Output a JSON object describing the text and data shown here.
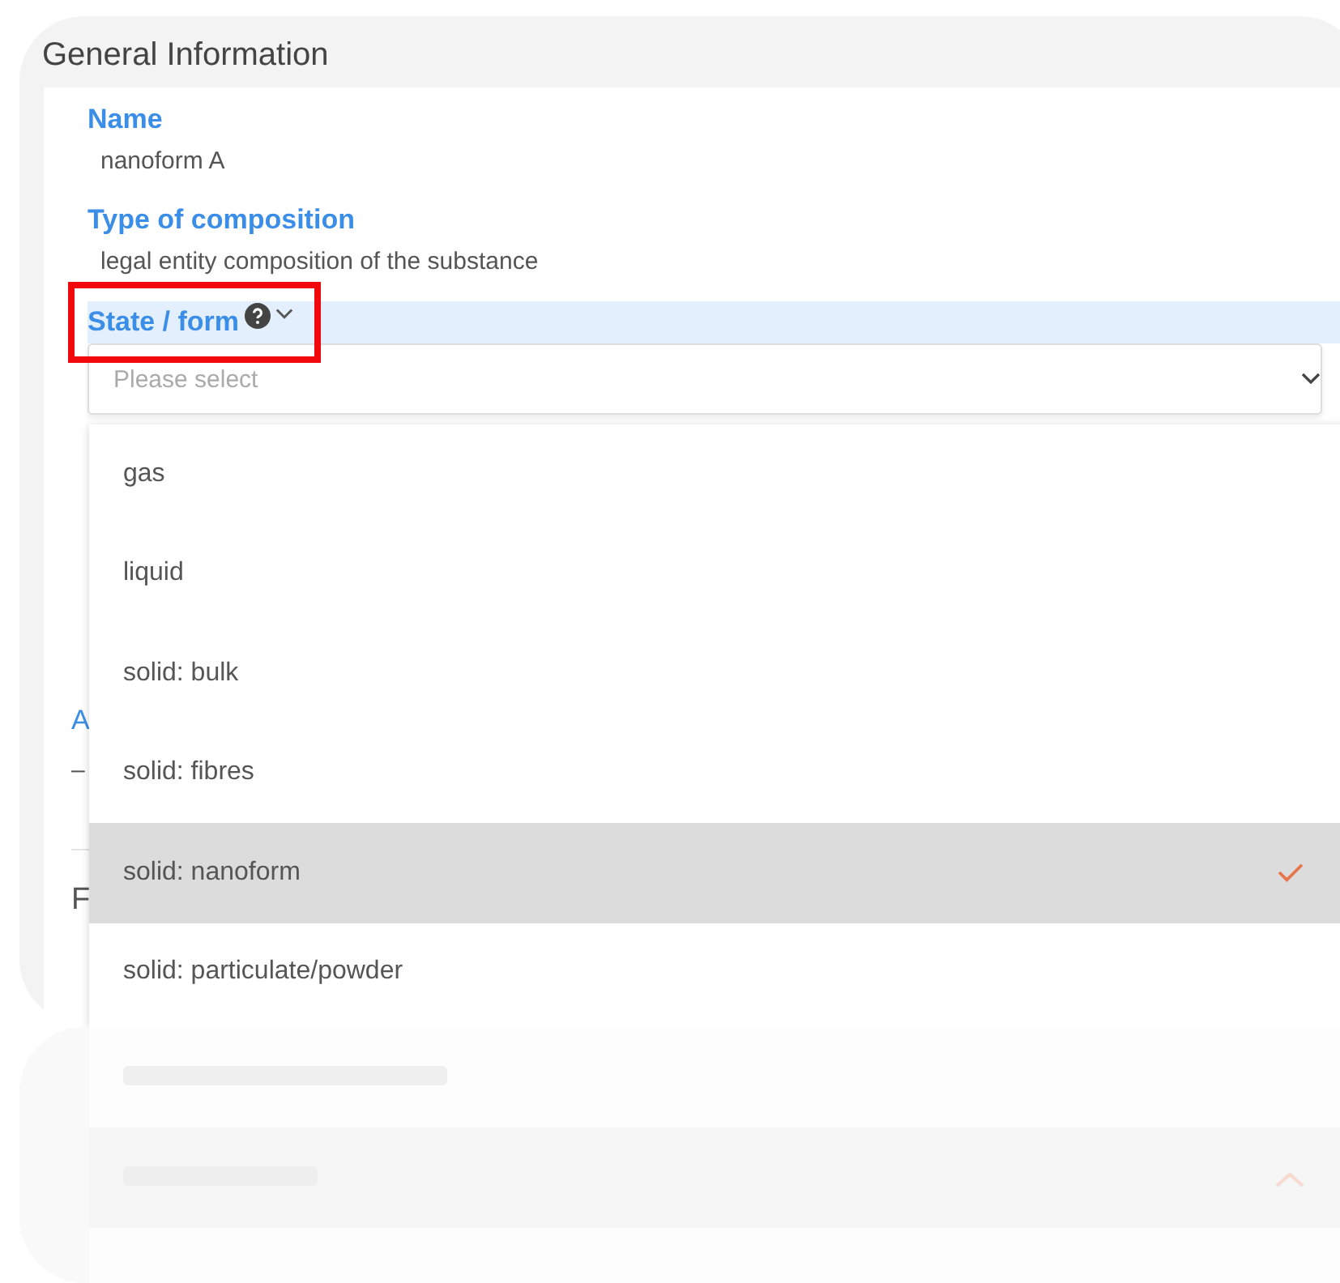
{
  "section": {
    "title": "General Information"
  },
  "fields": [
    {
      "label": "Name",
      "value": "nanoform A"
    },
    {
      "label": "Type of composition",
      "value": "legal entity composition of the substance"
    }
  ],
  "state_field": {
    "label": "State / form",
    "expanded": true,
    "placeholder": "Please select",
    "highlighted": true
  },
  "hidden_fields": [
    {
      "kind": "label",
      "text": "A"
    },
    {
      "kind": "value",
      "text": "–"
    },
    {
      "kind": "divider"
    },
    {
      "kind": "heading",
      "text": "F"
    }
  ],
  "options": [
    {
      "label": "gas",
      "selected": false
    },
    {
      "label": "liquid",
      "selected": false
    },
    {
      "label": "solid: bulk",
      "selected": false
    },
    {
      "label": "solid: fibres",
      "selected": false
    },
    {
      "label": "solid: nanoform",
      "selected": true
    },
    {
      "label": "solid: particulate/powder",
      "selected": false
    }
  ]
}
